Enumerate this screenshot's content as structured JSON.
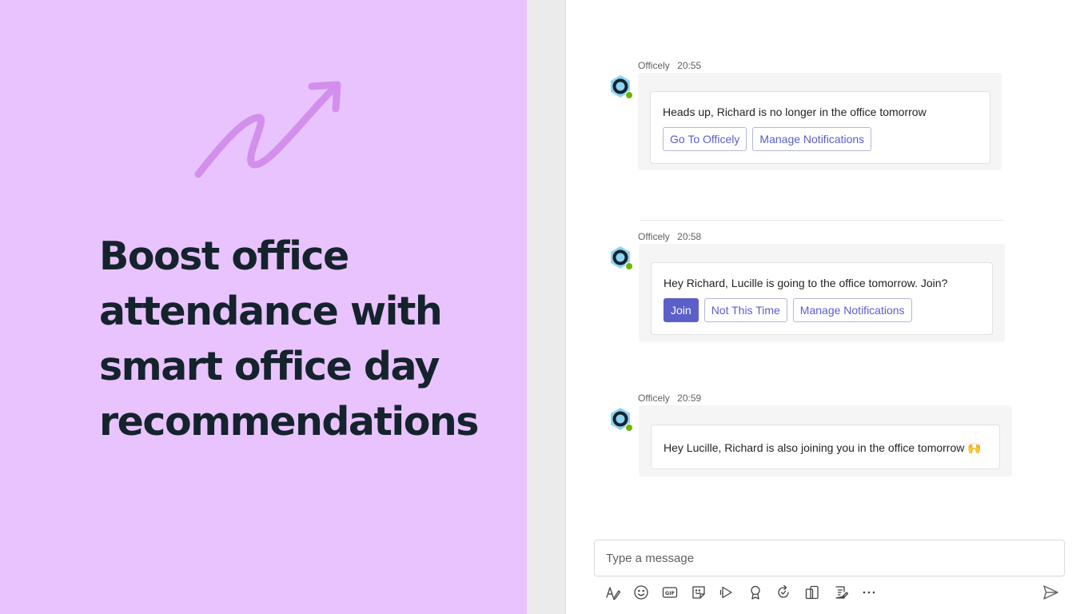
{
  "promo": {
    "headline_lines": [
      "Boost office",
      "attendance with",
      "smart office day",
      "recommendations"
    ],
    "background_color": "#e9c3fd",
    "arrow_color": "#d28fec",
    "text_color": "#14232c"
  },
  "chat": {
    "messages": [
      {
        "sender": "Officely",
        "time": "20:55",
        "text": "Heads up, Richard is no longer in the office tomorrow",
        "buttons": [
          {
            "label": "Go To Officely",
            "primary": false
          },
          {
            "label": "Manage Notifications",
            "primary": false
          }
        ]
      },
      {
        "sender": "Officely",
        "time": "20:58",
        "text": "Hey Richard, Lucille is going to the office tomorrow. Join?",
        "buttons": [
          {
            "label": "Join",
            "primary": true
          },
          {
            "label": "Not This Time",
            "primary": false
          },
          {
            "label": "Manage Notifications",
            "primary": false
          }
        ]
      },
      {
        "sender": "Officely",
        "time": "20:59",
        "text": "Hey Lucille, Richard is also joining you in the office tomorrow 🙌",
        "buttons": []
      }
    ],
    "compose": {
      "placeholder": "Type a message"
    },
    "toolbar_icons": [
      "format-icon",
      "emoji-icon",
      "gif-icon",
      "sticker-icon",
      "stream-icon",
      "praise-icon",
      "loop-icon",
      "apps-icon",
      "forms-icon",
      "more-icon"
    ],
    "send_icon": "send-icon",
    "accent_color": "#5b5fc7",
    "presence_color": "#6bb700"
  }
}
